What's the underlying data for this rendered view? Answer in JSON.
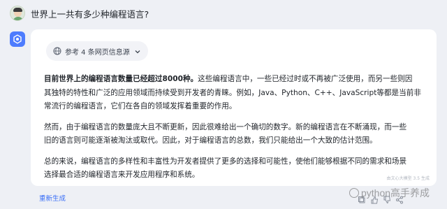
{
  "user": {
    "question": "世界上一共有多少种编程语言?"
  },
  "sources": {
    "label": "参考 4 条网页信息源"
  },
  "answer": {
    "p1_bold": "目前世界上的编程语言数量已经超过8000种。",
    "p1_rest_lines": [
      "这些编程语言中，一些已经过时或不再被广泛使用，而另一些则因",
      "其独特的特性和广泛的应用领域而持续受到开发者的青睐。例如，Java、Python、C++、JavaScript等都是当前非",
      "常流行的编程语言，它们在各自的领域发挥着重要的作用。"
    ],
    "p2_lines": [
      "然而，由于编程语言的数量庞大且不断更新，因此很难给出一个确切的数字。新的编程语言在不断涌现，而一些",
      "旧的语言则可能逐渐被淘汰或取代。因此，对于编程语言的总数，我们只能给出一个大致的估计范围。"
    ],
    "p3_lines": [
      "总的来说，编程语言的多样性和丰富性为开发者提供了更多的选择和可能性，使他们能够根据不同的需求和场景",
      "选择最合适的编程语言来开发应用程序和系统。"
    ]
  },
  "footer": {
    "model_note": "由文心大模型 3.5 生成",
    "regenerate": "重新生成"
  },
  "watermark": "python高手养成",
  "colors": {
    "accent": "#3a6ff7",
    "bot_icon": "#4d7cfe",
    "page_bg": "#eef0f5"
  }
}
